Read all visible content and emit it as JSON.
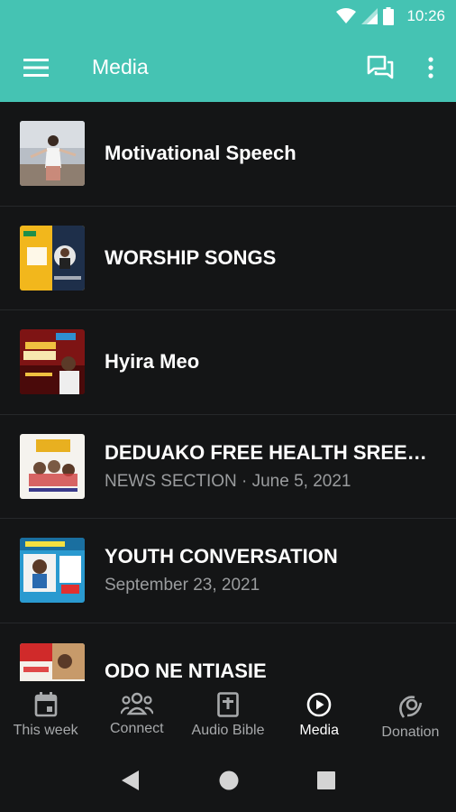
{
  "status_bar": {
    "time": "10:26",
    "icons": [
      "wifi-icon",
      "signal-icon",
      "battery-icon"
    ]
  },
  "app_bar": {
    "title": "Media",
    "icons": [
      "menu-icon",
      "chat-icon",
      "more-vertical-icon"
    ],
    "color": "#45c3b3"
  },
  "media_list": [
    {
      "title": "Motivational Speech",
      "subtitle": ""
    },
    {
      "title": "WORSHIP SONGS",
      "subtitle": ""
    },
    {
      "title": "Hyira Meo",
      "subtitle": ""
    },
    {
      "title": "DEDUAKO FREE HEALTH SREENI...",
      "subtitle": "NEWS SECTION · June 5, 2021"
    },
    {
      "title": "YOUTH CONVERSATION",
      "subtitle": "September 23, 2021"
    },
    {
      "title": "ODO NE NTIASIE",
      "subtitle": ""
    }
  ],
  "bottom_nav": [
    {
      "label": "This week",
      "icon": "calendar-icon",
      "active": false
    },
    {
      "label": "Connect",
      "icon": "people-icon",
      "active": false
    },
    {
      "label": "Audio Bible",
      "icon": "bible-icon",
      "active": false
    },
    {
      "label": "Media",
      "icon": "play-circle-icon",
      "active": true
    },
    {
      "label": "Donation",
      "icon": "donation-icon",
      "active": false
    }
  ],
  "system_nav": [
    "back-icon",
    "home-icon",
    "recents-icon"
  ]
}
